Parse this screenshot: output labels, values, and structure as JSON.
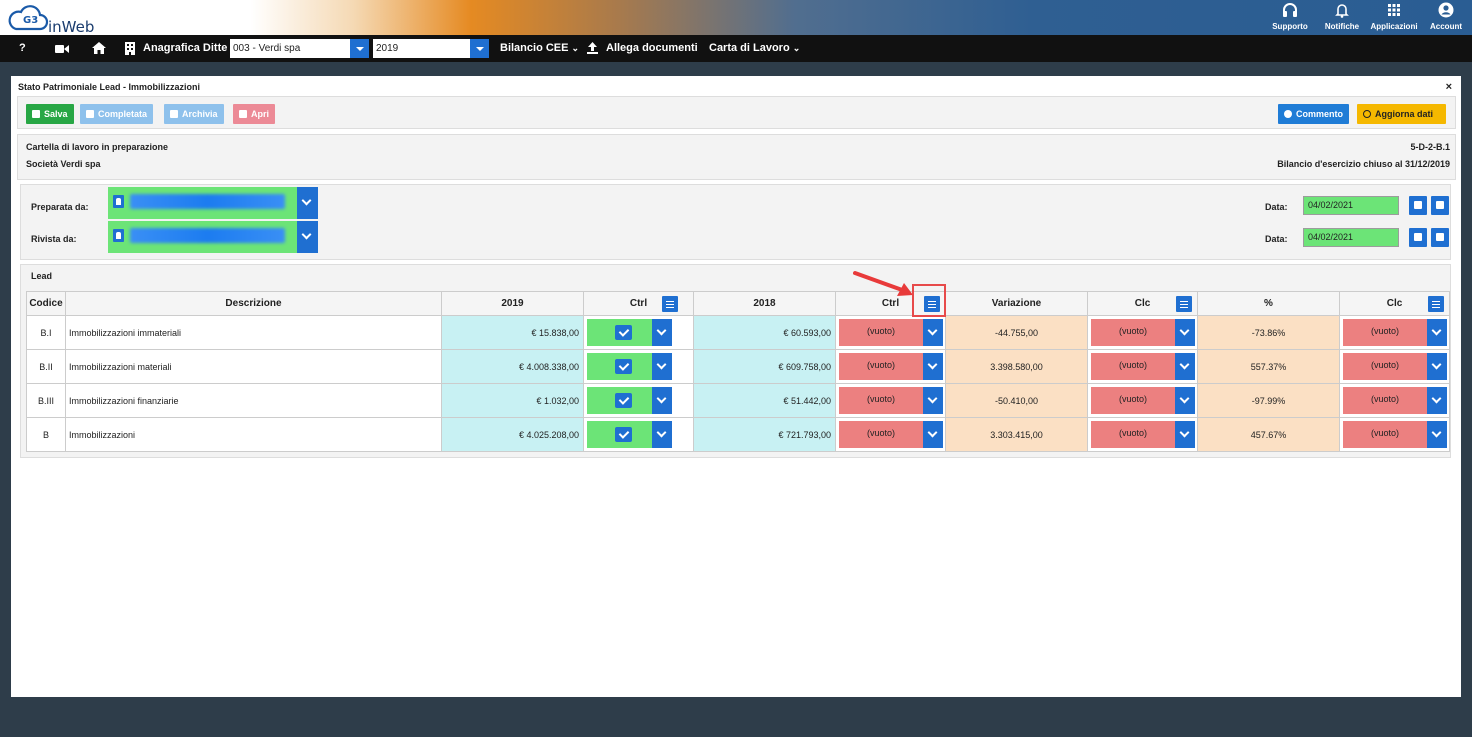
{
  "app": {
    "brand": "inWeb"
  },
  "top_icons": [
    {
      "label": "Supporto",
      "icon": "headset-icon"
    },
    {
      "label": "Notifiche",
      "icon": "bell-icon"
    },
    {
      "label": "Applicazioni",
      "icon": "grid-icon"
    },
    {
      "label": "Account",
      "icon": "user-circle-icon"
    }
  ],
  "nav": {
    "help": "?",
    "anagrafica": "Anagrafica Ditte",
    "company_select": "003 - Verdi spa",
    "year_select": "2019",
    "bilancio": "Bilancio CEE",
    "allega": "Allega documenti",
    "carta": "Carta di Lavoro"
  },
  "panel": {
    "title": "Stato Patrimoniale Lead - Immobilizzazioni",
    "close": "×"
  },
  "toolbar": {
    "salva": "Salva",
    "completata": "Completata",
    "archivia": "Archivia",
    "apri": "Apri",
    "commento": "Commento",
    "aggiorna": "Aggiorna dati"
  },
  "info": {
    "status": "Cartella di lavoro in preparazione",
    "company": "Società Verdi spa",
    "code": "5-D-2-B.1",
    "period": "Bilancio d'esercizio chiuso al 31/12/2019"
  },
  "people": {
    "preparata_label": "Preparata da:",
    "rivista_label": "Rivista da:",
    "data_label": "Data:",
    "preparata_date": "04/02/2021",
    "rivista_date": "04/02/2021"
  },
  "lead": {
    "title": "Lead",
    "headers": [
      "Codice",
      "Descrizione",
      "2019",
      "Ctrl",
      "2018",
      "Ctrl",
      "Variazione",
      "Clc",
      "%",
      "Clc"
    ],
    "empty_option": "(vuoto)",
    "rows": [
      {
        "code": "B.I",
        "desc": "Immobilizzazioni immateriali",
        "y2019": "€ 15.838,00",
        "y2018": "€ 60.593,00",
        "var": "-44.755,00",
        "pct": "-73.86%"
      },
      {
        "code": "B.II",
        "desc": "Immobilizzazioni materiali",
        "y2019": "€ 4.008.338,00",
        "y2018": "€ 609.758,00",
        "var": "3.398.580,00",
        "pct": "557.37%"
      },
      {
        "code": "B.III",
        "desc": "Immobilizzazioni finanziarie",
        "y2019": "€ 1.032,00",
        "y2018": "€ 51.442,00",
        "var": "-50.410,00",
        "pct": "-97.99%"
      },
      {
        "code": "B",
        "desc": "Immobilizzazioni",
        "y2019": "€ 4.025.208,00",
        "y2018": "€ 721.793,00",
        "var": "3.303.415,00",
        "pct": "457.67%"
      }
    ]
  },
  "colors": {
    "primary": "#1f6fd1",
    "success": "#28a745",
    "warning": "#f5b800",
    "danger": "#ec8080",
    "cyan_cell": "#c8f1f3",
    "peach_cell": "#fbe0c4",
    "green_field": "#6ce477"
  }
}
